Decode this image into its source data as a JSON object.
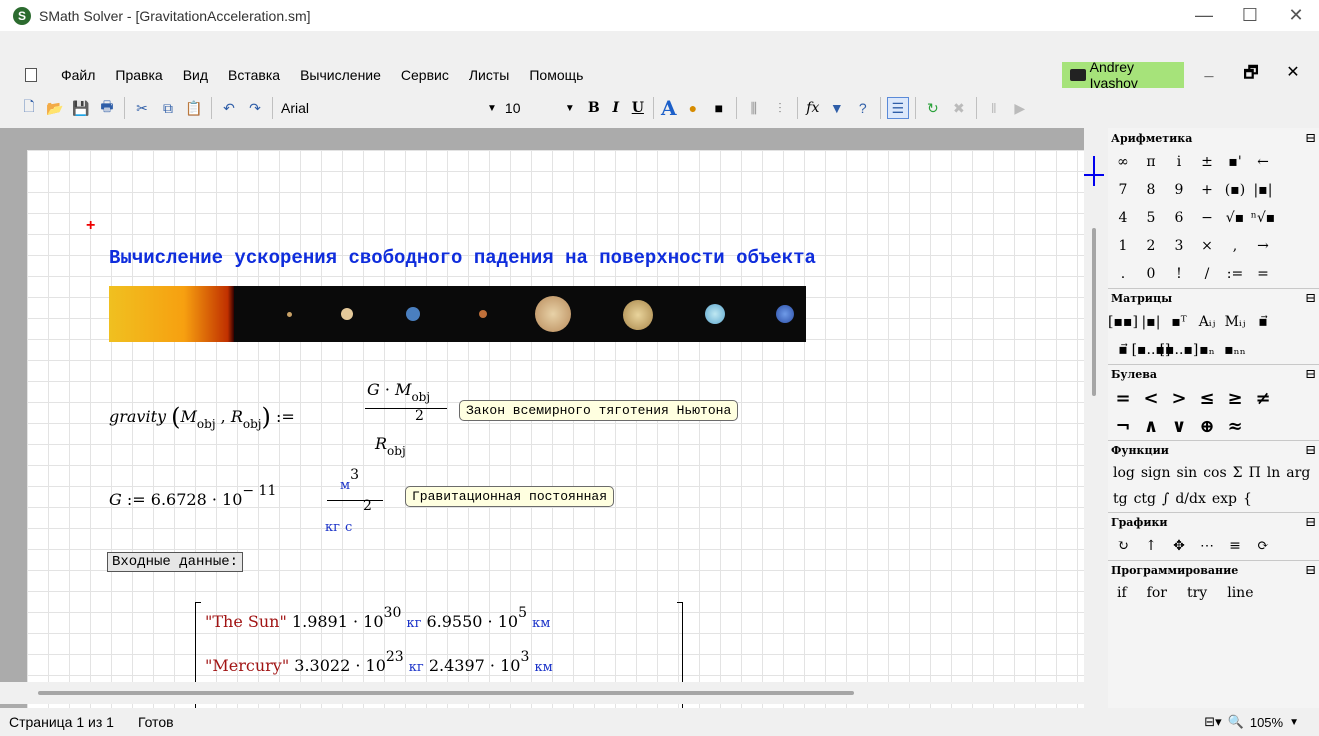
{
  "window": {
    "title": "SMath Solver - [GravitationAcceleration.sm]",
    "minimize": "—",
    "maximize": "☐",
    "close": "✕"
  },
  "menu": {
    "items": [
      "Файл",
      "Правка",
      "Вид",
      "Вставка",
      "Вычисление",
      "Сервис",
      "Листы",
      "Помощь"
    ],
    "user": "Andrey Ivashov",
    "mdi_min": "_",
    "mdi_restore": "🗗",
    "mdi_close": "✕"
  },
  "toolbar": {
    "font_name": "Arial",
    "font_size": "10",
    "bold": "B",
    "italic": "I",
    "underline": "U",
    "text_color": "A",
    "fx": "fx"
  },
  "document": {
    "heading": "Вычисление ускорения свободного падения на поверхности объекта",
    "gravity_fn": "gravity",
    "gravity_args_m": "M",
    "gravity_args_r": "R",
    "obj_sub": "obj",
    "assign": ":=",
    "g_num_g": "G",
    "exp2": "2",
    "note_newton": "Закон всемирного тяготения Ньютона",
    "G_lhs": "G",
    "G_value": "6.6728",
    "ten": "10",
    "G_exp": "− 11",
    "unit_m": "м",
    "exp3": "3",
    "unit_kg": "кг",
    "unit_s": "с",
    "note_G": "Гравитационная постоянная",
    "inputs_label": "Входные данные:",
    "rows": [
      {
        "name": "\"The Sun\"",
        "mass": "1.9891",
        "mass_exp": "30",
        "mass_unit": "кг",
        "radius": "6.9550",
        "radius_exp": "5",
        "radius_unit": "км"
      },
      {
        "name": "\"Mercury\"",
        "mass": "3.3022",
        "mass_exp": "23",
        "mass_unit": "кг",
        "radius": "2.4397",
        "radius_exp": "3",
        "radius_unit": "км"
      }
    ]
  },
  "palette": {
    "arithmetic": {
      "title": "Арифметика",
      "cells": [
        "∞",
        "π",
        "i",
        "±",
        "▪'",
        "←",
        "",
        "7",
        "8",
        "9",
        "+",
        "(▪)",
        "|▪|",
        "",
        "4",
        "5",
        "6",
        "−",
        "√▪",
        "ⁿ√▪",
        "",
        "1",
        "2",
        "3",
        "×",
        ",",
        "→",
        "",
        ".",
        "0",
        "!",
        "/",
        ":=",
        "=",
        ""
      ]
    },
    "matrices": {
      "title": "Матрицы",
      "cells": [
        "[▪▪]",
        "|▪|",
        "▪ᵀ",
        "Aᵢⱼ",
        "Mᵢⱼ",
        "▪⃗",
        "",
        "▪⃗",
        "[▪..▪]",
        "[▪..▪]",
        "▪ₙ",
        "▪ₙₙ",
        "",
        ""
      ]
    },
    "boolean": {
      "title": "Булева",
      "cells": [
        "=",
        "<",
        ">",
        "≤",
        "≥",
        "≠",
        "",
        "¬",
        "∧",
        "∨",
        "⊕",
        "≈",
        "",
        ""
      ]
    },
    "functions": {
      "title": "Функции",
      "items": [
        "log",
        "sign",
        "sin",
        "cos",
        "Σ",
        "Π",
        "ln",
        "arg",
        "tg",
        "ctg",
        "∫",
        "d/dx",
        "exp",
        "{"
      ]
    },
    "graphs": {
      "title": "Графики",
      "cells": [
        "↻",
        "↑",
        "✥",
        "⋯",
        "≡",
        "⟳",
        ""
      ]
    },
    "programming": {
      "title": "Программирование",
      "items": [
        "if",
        "for",
        "try",
        "line"
      ]
    },
    "collapse": "⊟"
  },
  "status": {
    "page": "Страница 1 из 1",
    "state": "Готов",
    "zoom": "105%"
  }
}
